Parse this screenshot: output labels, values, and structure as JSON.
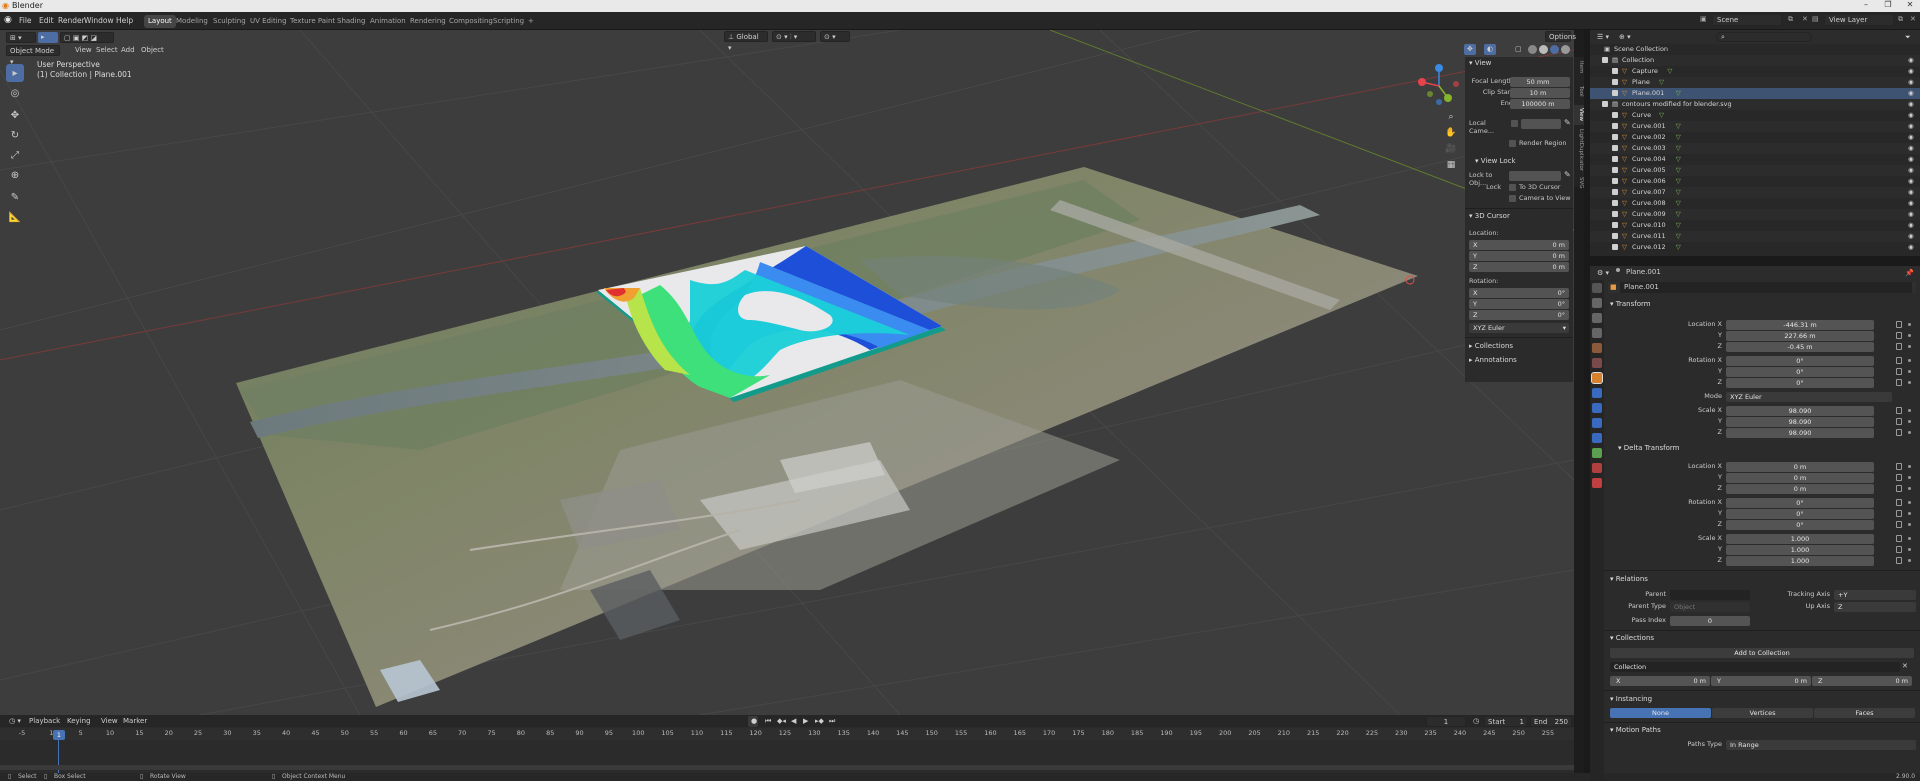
{
  "window": {
    "title": "Blender"
  },
  "menu": [
    "File",
    "Edit",
    "Render",
    "Window",
    "Help"
  ],
  "workspaces": [
    "Layout",
    "Modeling",
    "Sculpting",
    "UV Editing",
    "Texture Paint",
    "Shading",
    "Animation",
    "Rendering",
    "Compositing",
    "Scripting",
    "+"
  ],
  "header_right": {
    "scene": "Scene",
    "view_layer": "View Layer"
  },
  "viewport": {
    "mode": "Object Mode",
    "menus": [
      "View",
      "Select",
      "Add",
      "Object"
    ],
    "transform_orientation": "Global",
    "options_label": "Options",
    "info_line1": "User Perspective",
    "info_line2": "(1) Collection | Plane.001"
  },
  "npanel": {
    "tabs": [
      "Item",
      "Tool",
      "View",
      "LightDuplicator",
      "SVG"
    ],
    "view_section": "View",
    "focal_length_label": "Focal Length",
    "focal_length": "50 mm",
    "clip_start_label": "Clip Start",
    "clip_start": "10 m",
    "end_label": "End",
    "clip_end": "100000 m",
    "local_camera_label": "Local Came...",
    "render_region_label": "Render Region",
    "view_lock_label": "View Lock",
    "lock_to_obj_label": "Lock to Obj...",
    "lock_label": "Lock",
    "to_3d_cursor_label": "To 3D Cursor",
    "camera_to_view_label": "Camera to View",
    "cursor_section": "3D Cursor",
    "location_label": "Location:",
    "rotation_label": "Rotation:",
    "x_label": "X",
    "y_label": "Y",
    "z_label": "Z",
    "cursor_loc": [
      "0 m",
      "0 m",
      "0 m"
    ],
    "cursor_rot": [
      "0°",
      "0°",
      "0°"
    ],
    "rotation_mode": "XYZ Euler",
    "collections_label": "Collections",
    "annotations_label": "Annotations"
  },
  "timeline": {
    "menus": [
      "Playback",
      "Keying",
      "View",
      "Marker"
    ],
    "current_frame": "1",
    "start_label": "Start",
    "start": "1",
    "end_label": "End",
    "end": "250",
    "ticks": [
      "-5",
      "1",
      "5",
      "10",
      "15",
      "20",
      "25",
      "30",
      "35",
      "40",
      "45",
      "50",
      "55",
      "60",
      "65",
      "70",
      "75",
      "80",
      "85",
      "90",
      "95",
      "100",
      "105",
      "110",
      "115",
      "120",
      "125",
      "130",
      "135",
      "140",
      "145",
      "150",
      "155",
      "160",
      "165",
      "170",
      "175",
      "180",
      "185",
      "190",
      "195",
      "200",
      "205",
      "210",
      "215",
      "220",
      "225",
      "230",
      "235",
      "240",
      "245",
      "250",
      "255"
    ]
  },
  "statusbar": {
    "select": "Select",
    "box_select": "Box Select",
    "rotate_view": "Rotate View",
    "context_menu": "Object Context Menu",
    "version": "2.90.0"
  },
  "outliner": {
    "root": "Scene Collection",
    "items": [
      {
        "name": "Collection",
        "indent": 1,
        "type": "collection"
      },
      {
        "name": "Capture",
        "indent": 2,
        "type": "object"
      },
      {
        "name": "Plane",
        "indent": 2,
        "type": "object"
      },
      {
        "name": "Plane.001",
        "indent": 2,
        "type": "object"
      },
      {
        "name": "contours modified for blender.svg",
        "indent": 1,
        "type": "collection"
      },
      {
        "name": "Curve",
        "indent": 2,
        "type": "object"
      },
      {
        "name": "Curve.001",
        "indent": 2,
        "type": "object"
      },
      {
        "name": "Curve.002",
        "indent": 2,
        "type": "object"
      },
      {
        "name": "Curve.003",
        "indent": 2,
        "type": "object"
      },
      {
        "name": "Curve.004",
        "indent": 2,
        "type": "object"
      },
      {
        "name": "Curve.005",
        "indent": 2,
        "type": "object"
      },
      {
        "name": "Curve.006",
        "indent": 2,
        "type": "object"
      },
      {
        "name": "Curve.007",
        "indent": 2,
        "type": "object"
      },
      {
        "name": "Curve.008",
        "indent": 2,
        "type": "object"
      },
      {
        "name": "Curve.009",
        "indent": 2,
        "type": "object"
      },
      {
        "name": "Curve.010",
        "indent": 2,
        "type": "object"
      },
      {
        "name": "Curve.011",
        "indent": 2,
        "type": "object"
      },
      {
        "name": "Curve.012",
        "indent": 2,
        "type": "object"
      }
    ]
  },
  "properties": {
    "object_name": "Plane.001",
    "object_name2": "Plane.001",
    "transform_label": "Transform",
    "location_x_label": "Location X",
    "location": [
      "-446.31 m",
      "227.66 m",
      "-0.45 m"
    ],
    "rotation_x_label": "Rotation X",
    "rotation": [
      "0°",
      "0°",
      "0°"
    ],
    "mode_label": "Mode",
    "mode": "XYZ Euler",
    "scale_x_label": "Scale X",
    "scale": [
      "98.090",
      "98.090",
      "98.090"
    ],
    "delta_label": "Delta Transform",
    "delta_location": [
      "0 m",
      "0 m",
      "0 m"
    ],
    "delta_rotation": [
      "0°",
      "0°",
      "0°"
    ],
    "delta_scale": [
      "1.000",
      "1.000",
      "1.000"
    ],
    "y_label": "Y",
    "z_label": "Z",
    "relations_label": "Relations",
    "parent_label": "Parent",
    "parent_type_label": "Parent Type",
    "parent_type": "Object",
    "tracking_axis_label": "Tracking Axis",
    "tracking_axis": "+Y",
    "up_axis_label": "Up Axis",
    "up_axis": "Z",
    "pass_index_label": "Pass Index",
    "pass_index": "0",
    "collections_label": "Collections",
    "add_to_collection": "Add to Collection",
    "collection_name": "Collection",
    "coll_x_label": "X",
    "coll_x": "0 m",
    "coll_y_label": "Y",
    "coll_y": "0 m",
    "coll_z_label": "Z",
    "coll_z": "0 m",
    "instancing_label": "Instancing",
    "instancing_none": "None",
    "instancing_vertices": "Vertices",
    "instancing_faces": "Faces",
    "motion_paths_label": "Motion Paths",
    "paths_type_label": "Paths Type",
    "paths_type": "In Range"
  },
  "colors": {
    "accent": "#4772b3",
    "bg": "#3d3d3d",
    "panel": "#2b2b2b",
    "x_axis": "#e8434d",
    "y_axis": "#86b52a",
    "z_axis": "#3b8ae6"
  }
}
